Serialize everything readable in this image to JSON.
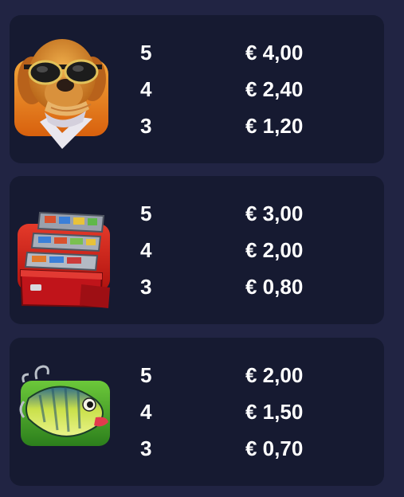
{
  "colors": {
    "background": "#212443",
    "card": "#161a31",
    "text": "#ffffff"
  },
  "symbols": [
    {
      "icon": "dog-with-sunglasses-icon",
      "payouts": [
        {
          "count": "5",
          "prize": "€ 4,00"
        },
        {
          "count": "4",
          "prize": "€ 2,40"
        },
        {
          "count": "3",
          "prize": "€ 1,20"
        }
      ]
    },
    {
      "icon": "tackle-box-icon",
      "payouts": [
        {
          "count": "5",
          "prize": "€ 3,00"
        },
        {
          "count": "4",
          "prize": "€ 2,00"
        },
        {
          "count": "3",
          "prize": "€ 0,80"
        }
      ]
    },
    {
      "icon": "fishing-lure-icon",
      "payouts": [
        {
          "count": "5",
          "prize": "€ 2,00"
        },
        {
          "count": "4",
          "prize": "€ 1,50"
        },
        {
          "count": "3",
          "prize": "€ 0,70"
        }
      ]
    }
  ]
}
